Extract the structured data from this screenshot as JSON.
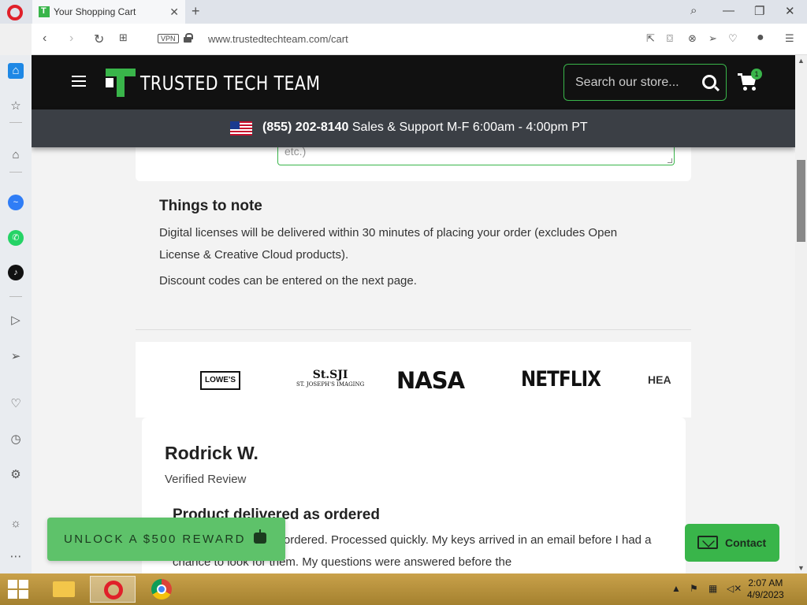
{
  "browser": {
    "tab_title": "Your Shopping Cart",
    "url": "www.trustedtechteam.com/cart",
    "vpn_label": "VPN"
  },
  "site": {
    "brand_name": "TRUSTED TECH TEAM",
    "search_placeholder": "Search our store...",
    "cart_count": "1",
    "support_phone": "(855) 202-8140",
    "support_hours": "Sales & Support M-F 6:00am - 4:00pm PT"
  },
  "form": {
    "textarea_visible_text": "etc.)"
  },
  "notes": {
    "title": "Things to note",
    "line1": "Digital licenses will be delivered within 30 minutes of placing your order (excludes Open License & Creative Cloud products).",
    "line2": "Discount codes can be entered on the next page."
  },
  "client_logos": {
    "lowes": "LOWE'S",
    "sji_main": "St.SJI",
    "sji_sub": "ST. JOSEPH'S IMAGING",
    "nasa": "NASA",
    "netflix": "NETFLIX",
    "partial": "HEA"
  },
  "review": {
    "reviewer": "Rodrick W.",
    "verified": "Verified Review",
    "title": "Product delivered as ordered",
    "body": "Product delivered as ordered. Processed quickly. My keys arrived in an email before I had a chance to look for them. My questions were answered before the"
  },
  "widgets": {
    "reward_label": "UNLOCK A $500 REWARD",
    "contact_label": "Contact"
  },
  "taskbar": {
    "time": "2:07 AM",
    "date": "4/9/2023"
  },
  "colors": {
    "brand_green": "#39b54a",
    "header_black": "#111111",
    "support_bar": "#3b3f45",
    "taskbar_gold": "#b8923c"
  }
}
